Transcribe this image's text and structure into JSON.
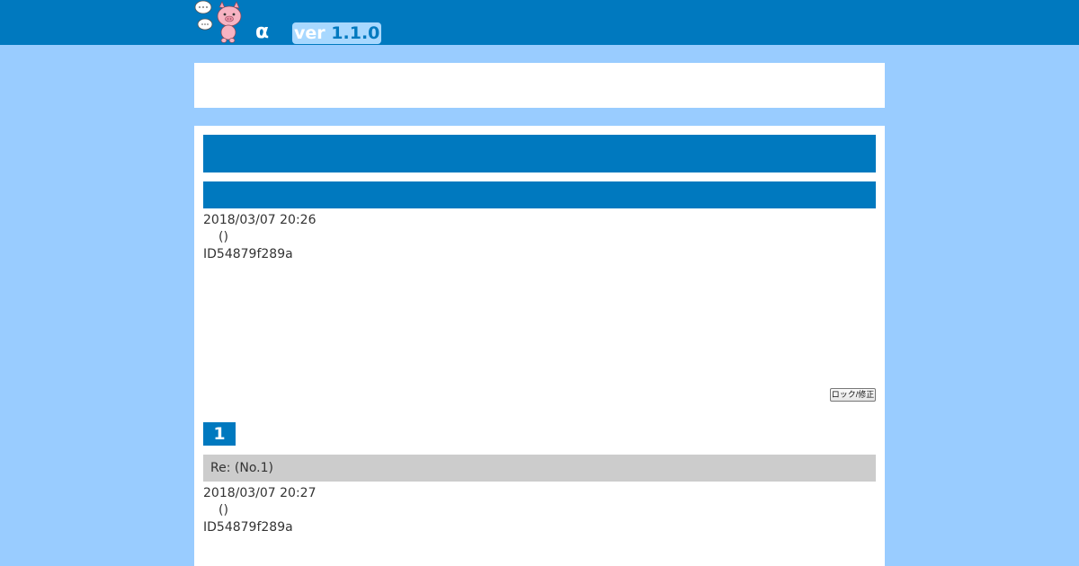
{
  "header": {
    "alpha": "α",
    "version_prefix": "ver",
    "version_number": "1.1.0",
    "colors": {
      "bar": "#0079bf",
      "page_bg": "#99ccff"
    },
    "logo_icon": "pig-mascot-icon"
  },
  "post": {
    "date": "2018/03/07 20:26",
    "name": "()",
    "id": "ID54879f289a",
    "lock_button_label": "ロック/修正"
  },
  "reply": {
    "number": "1",
    "subject": "Re:  (No.1)",
    "date": "2018/03/07 20:27",
    "name": "()",
    "id": "ID54879f289a"
  }
}
